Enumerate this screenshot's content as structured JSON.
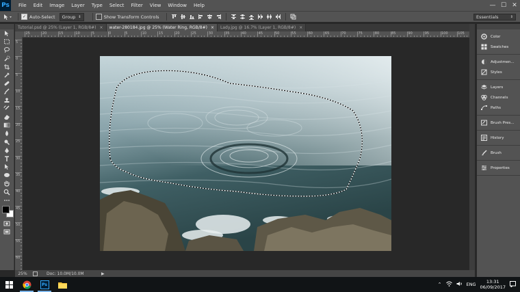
{
  "app": {
    "logo": "Ps"
  },
  "menu": [
    "File",
    "Edit",
    "Image",
    "Layer",
    "Type",
    "Select",
    "Filter",
    "View",
    "Window",
    "Help"
  ],
  "window_controls": {
    "minimize": "—",
    "maximize": "☐",
    "close": "✕"
  },
  "options": {
    "auto_select_label": "Auto-Select",
    "auto_select_checked": true,
    "auto_select_target": "Group",
    "show_transform_label": "Show Transform Controls",
    "show_transform_checked": false,
    "workspace": "Essentials"
  },
  "tabs": [
    {
      "label": "Tutorial.psd @ 25% (Layer 1, RGB/8#)",
      "close": "×",
      "active": false
    },
    {
      "label": "water-280184.jpg @ 25% (Water Ring, RGB/8#)",
      "close": "×",
      "active": true
    },
    {
      "label": "Lady.jpg @ 16.7% (Layer 1, RGB/8#)",
      "close": "×",
      "active": false
    }
  ],
  "ruler_top_labels": [
    "25",
    "20",
    "15",
    "10",
    "5",
    "0",
    "5",
    "10",
    "15",
    "20",
    "25",
    "30",
    "35",
    "40",
    "45",
    "50",
    "55",
    "60",
    "65",
    "70",
    "75",
    "80",
    "85",
    "90",
    "95",
    "100",
    "105"
  ],
  "ruler_left_labels": [
    "5",
    "0",
    "5",
    "10",
    "15",
    "20",
    "25",
    "30",
    "35",
    "40",
    "45",
    "50",
    "55",
    "60",
    "65"
  ],
  "status": {
    "zoom": "25%",
    "doc": "Doc: 10.0M/10.0M"
  },
  "panels": [
    {
      "group": [
        {
          "label": "Color",
          "icon": "color-wheel-icon"
        },
        {
          "label": "Swatches",
          "icon": "swatches-icon"
        }
      ]
    },
    {
      "group": [
        {
          "label": "Adjustmen...",
          "icon": "adjustments-icon"
        },
        {
          "label": "Styles",
          "icon": "styles-icon"
        }
      ]
    },
    {
      "group": [
        {
          "label": "Layers",
          "icon": "layers-icon"
        },
        {
          "label": "Channels",
          "icon": "channels-icon"
        },
        {
          "label": "Paths",
          "icon": "paths-icon"
        }
      ]
    },
    {
      "group": [
        {
          "label": "Brush Pres...",
          "icon": "brush-presets-icon"
        }
      ]
    },
    {
      "group": [
        {
          "label": "History",
          "icon": "history-icon"
        }
      ]
    },
    {
      "group": [
        {
          "label": "Brush",
          "icon": "brush-icon"
        }
      ]
    },
    {
      "group": [
        {
          "label": "Properties",
          "icon": "properties-icon"
        }
      ]
    }
  ],
  "colors": {
    "foreground": "#000000",
    "background": "#ffffff",
    "accent": "#31a8ff"
  },
  "taskbar": {
    "apps": [
      "windows-start-icon",
      "chrome-icon",
      "photoshop-icon",
      "file-explorer-icon"
    ],
    "lang": "ENG",
    "time": "13:31",
    "date": "06/09/2017"
  }
}
